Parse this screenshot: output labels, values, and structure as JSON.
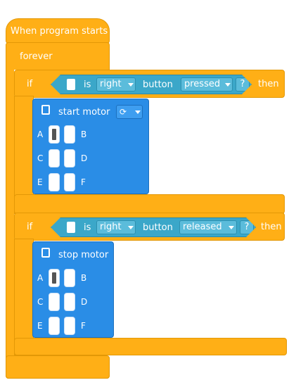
{
  "start_block": {
    "label": "When program starts"
  },
  "forever_block": {
    "label": "forever"
  },
  "if_block_1": {
    "if_label": "if",
    "then_label": "then",
    "condition": {
      "icon": "hub-icon",
      "is_label": "is",
      "side_value": "right",
      "button_label": "button",
      "state_value": "pressed",
      "question": "?"
    },
    "action": {
      "label": "start motor",
      "direction_icon": "clockwise-icon",
      "ports": [
        "A",
        "B",
        "C",
        "D",
        "E",
        "F"
      ],
      "selected_port": "A"
    }
  },
  "if_block_2": {
    "if_label": "if",
    "then_label": "then",
    "condition": {
      "icon": "hub-icon",
      "is_label": "is",
      "side_value": "right",
      "button_label": "button",
      "state_value": "released",
      "question": "?"
    },
    "action": {
      "label": "stop motor",
      "ports": [
        "A",
        "B",
        "C",
        "D",
        "E",
        "F"
      ],
      "selected_port": "A"
    }
  },
  "colors": {
    "orange": "#FFAF16",
    "blue": "#2A8DE6",
    "cyan": "#3BA7C9"
  }
}
